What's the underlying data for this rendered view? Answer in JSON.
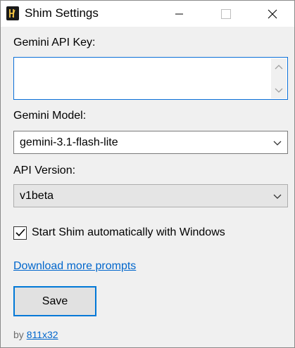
{
  "window": {
    "title": "Shim Settings",
    "icon": "shim-app-icon"
  },
  "form": {
    "api_key_label": "Gemini API Key:",
    "api_key_value": "",
    "model_label": "Gemini Model:",
    "model_value": "gemini-3.1-flash-lite",
    "api_version_label": "API Version:",
    "api_version_value": "v1beta",
    "autostart_label": "Start Shim automatically with Windows",
    "autostart_checked": true
  },
  "links": {
    "download_prompts": "Download more prompts"
  },
  "buttons": {
    "save": "Save"
  },
  "footer": {
    "prefix": "by",
    "author": "811x32"
  },
  "colors": {
    "accent": "#0078d7",
    "link": "#0066cc",
    "background": "#f0f0f0"
  }
}
